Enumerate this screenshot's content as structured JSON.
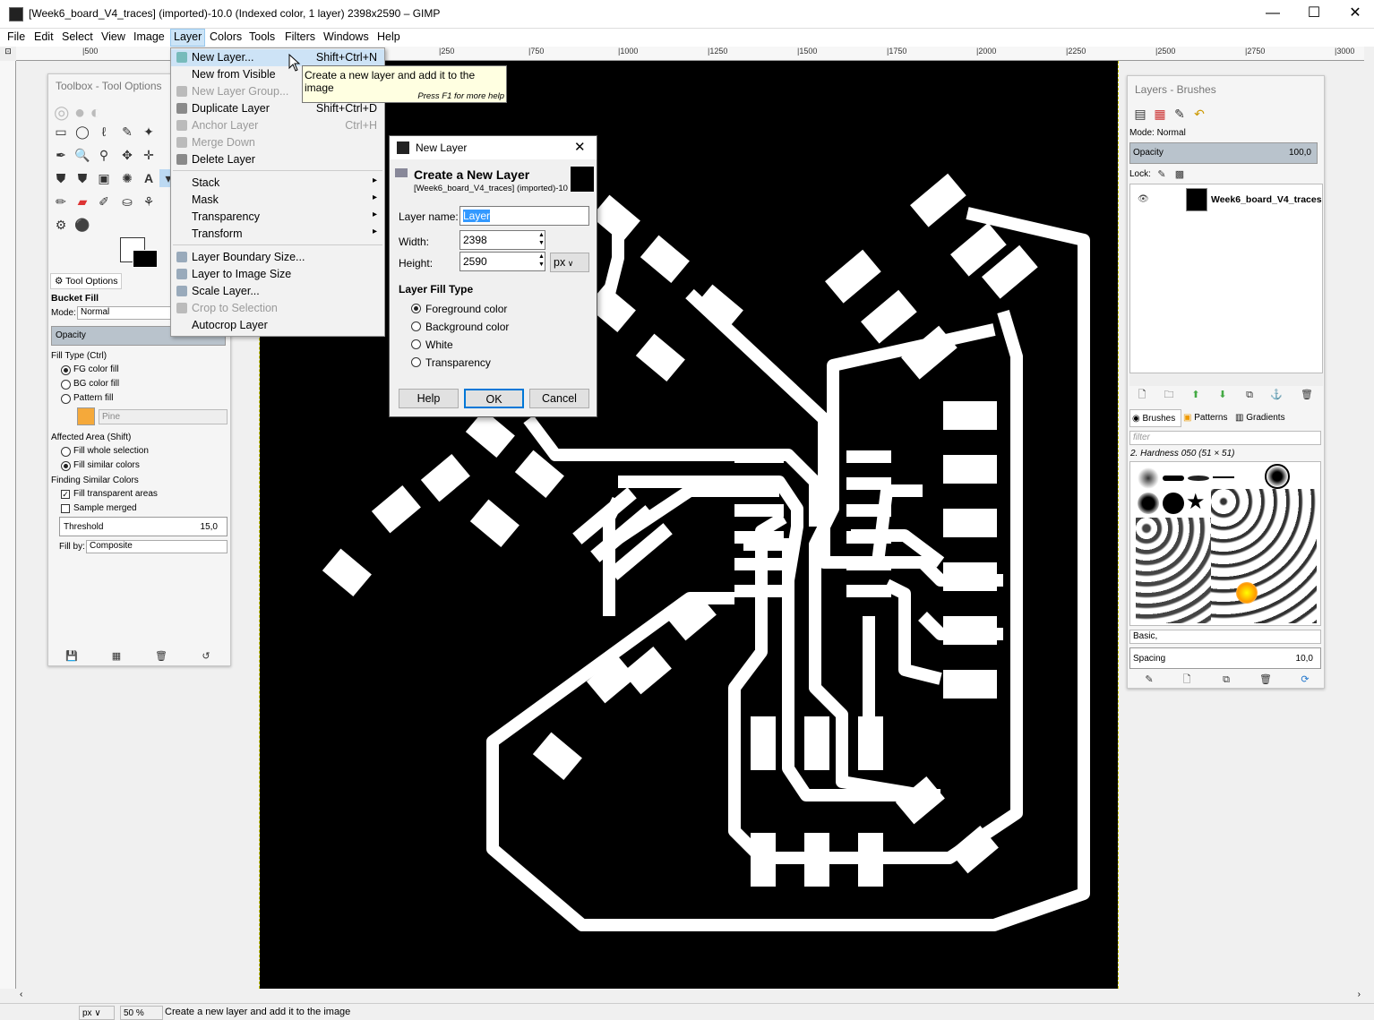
{
  "window": {
    "title": "[Week6_board_V4_traces] (imported)-10.0 (Indexed color, 1 layer) 2398x2590 – GIMP",
    "min": "—",
    "max": "☐",
    "close": "✕"
  },
  "menubar": [
    "File",
    "Edit",
    "Select",
    "View",
    "Image",
    "Layer",
    "Colors",
    "Tools",
    "Filters",
    "Windows",
    "Help"
  ],
  "ruler": [
    "|500",
    "|250",
    "|0",
    "|250",
    "|500",
    "|750",
    "|1000",
    "|1250",
    "|1500",
    "|1750",
    "|2000",
    "|2250",
    "|2500",
    "|2750",
    "|3000"
  ],
  "layer_menu": {
    "items": [
      {
        "label": "New Layer...",
        "shortcut": "Shift+Ctrl+N",
        "enabled": true,
        "highlighted": true
      },
      {
        "label": "New from Visible",
        "shortcut": "",
        "enabled": true
      },
      {
        "label": "New Layer Group...",
        "shortcut": "",
        "enabled": false
      },
      {
        "label": "Duplicate Layer",
        "shortcut": "Shift+Ctrl+D",
        "enabled": true
      },
      {
        "label": "Anchor Layer",
        "shortcut": "Ctrl+H",
        "enabled": false
      },
      {
        "label": "Merge Down",
        "shortcut": "",
        "enabled": false
      },
      {
        "label": "Delete Layer",
        "shortcut": "",
        "enabled": true
      },
      {
        "label": "Stack",
        "submenu": true
      },
      {
        "label": "Mask",
        "submenu": true
      },
      {
        "label": "Transparency",
        "submenu": true
      },
      {
        "label": "Transform",
        "submenu": true
      },
      {
        "label": "Layer Boundary Size...",
        "enabled": true
      },
      {
        "label": "Layer to Image Size",
        "enabled": true
      },
      {
        "label": "Scale Layer...",
        "enabled": true
      },
      {
        "label": "Crop to Selection",
        "enabled": false
      },
      {
        "label": "Autocrop Layer",
        "enabled": true
      }
    ]
  },
  "tooltip": {
    "text": "Create a new layer and add it to the image",
    "hint": "Press F1 for more help"
  },
  "dialog": {
    "window_title": "New Layer",
    "heading": "Create a New Layer",
    "subheading": "[Week6_board_V4_traces] (imported)-10",
    "layer_name_label": "Layer name:",
    "layer_name_value": "Layer",
    "width_label": "Width:",
    "width_value": "2398",
    "height_label": "Height:",
    "height_value": "2590",
    "unit": "px",
    "fill_type_label": "Layer Fill Type",
    "fill_options": [
      "Foreground color",
      "Background color",
      "White",
      "Transparency"
    ],
    "selected_fill": "Foreground color",
    "help": "Help",
    "ok": "OK",
    "cancel": "Cancel"
  },
  "toolbox": {
    "title": "Toolbox - Tool Options",
    "tab": "Tool Options",
    "tool_name": "Bucket Fill",
    "mode_label": "Mode:",
    "mode_value": "Normal",
    "opacity_label": "Opacity",
    "opacity_value": "100,0",
    "fill_type_label": "Fill Type  (Ctrl)",
    "fill_options": [
      "FG color fill",
      "BG color fill",
      "Pattern fill"
    ],
    "pattern_name": "Pine",
    "affected_label": "Affected Area  (Shift)",
    "affected_options": [
      "Fill whole selection",
      "Fill similar colors"
    ],
    "finding_label": "Finding Similar Colors",
    "fill_transparent": "Fill transparent areas",
    "sample_merged": "Sample merged",
    "threshold_label": "Threshold",
    "threshold_value": "15,0",
    "fillby_label": "Fill by:",
    "fillby_value": "Composite"
  },
  "layers_panel": {
    "title": "Layers - Brushes",
    "mode_label": "Mode: Normal",
    "opacity_label": "Opacity",
    "opacity_value": "100,0",
    "lock_label": "Lock:",
    "layer_name": "Week6_board_V4_traces.png",
    "tabs": [
      "Brushes",
      "Patterns",
      "Gradients"
    ],
    "filter_placeholder": "filter",
    "brush_name": "2. Hardness 050 (51 × 51)",
    "brush_tag": "Basic,",
    "spacing_label": "Spacing",
    "spacing_value": "10,0"
  },
  "statusbar": {
    "unit": "px",
    "zoom": "50 %",
    "message": "Create a new layer and add it to the image"
  }
}
